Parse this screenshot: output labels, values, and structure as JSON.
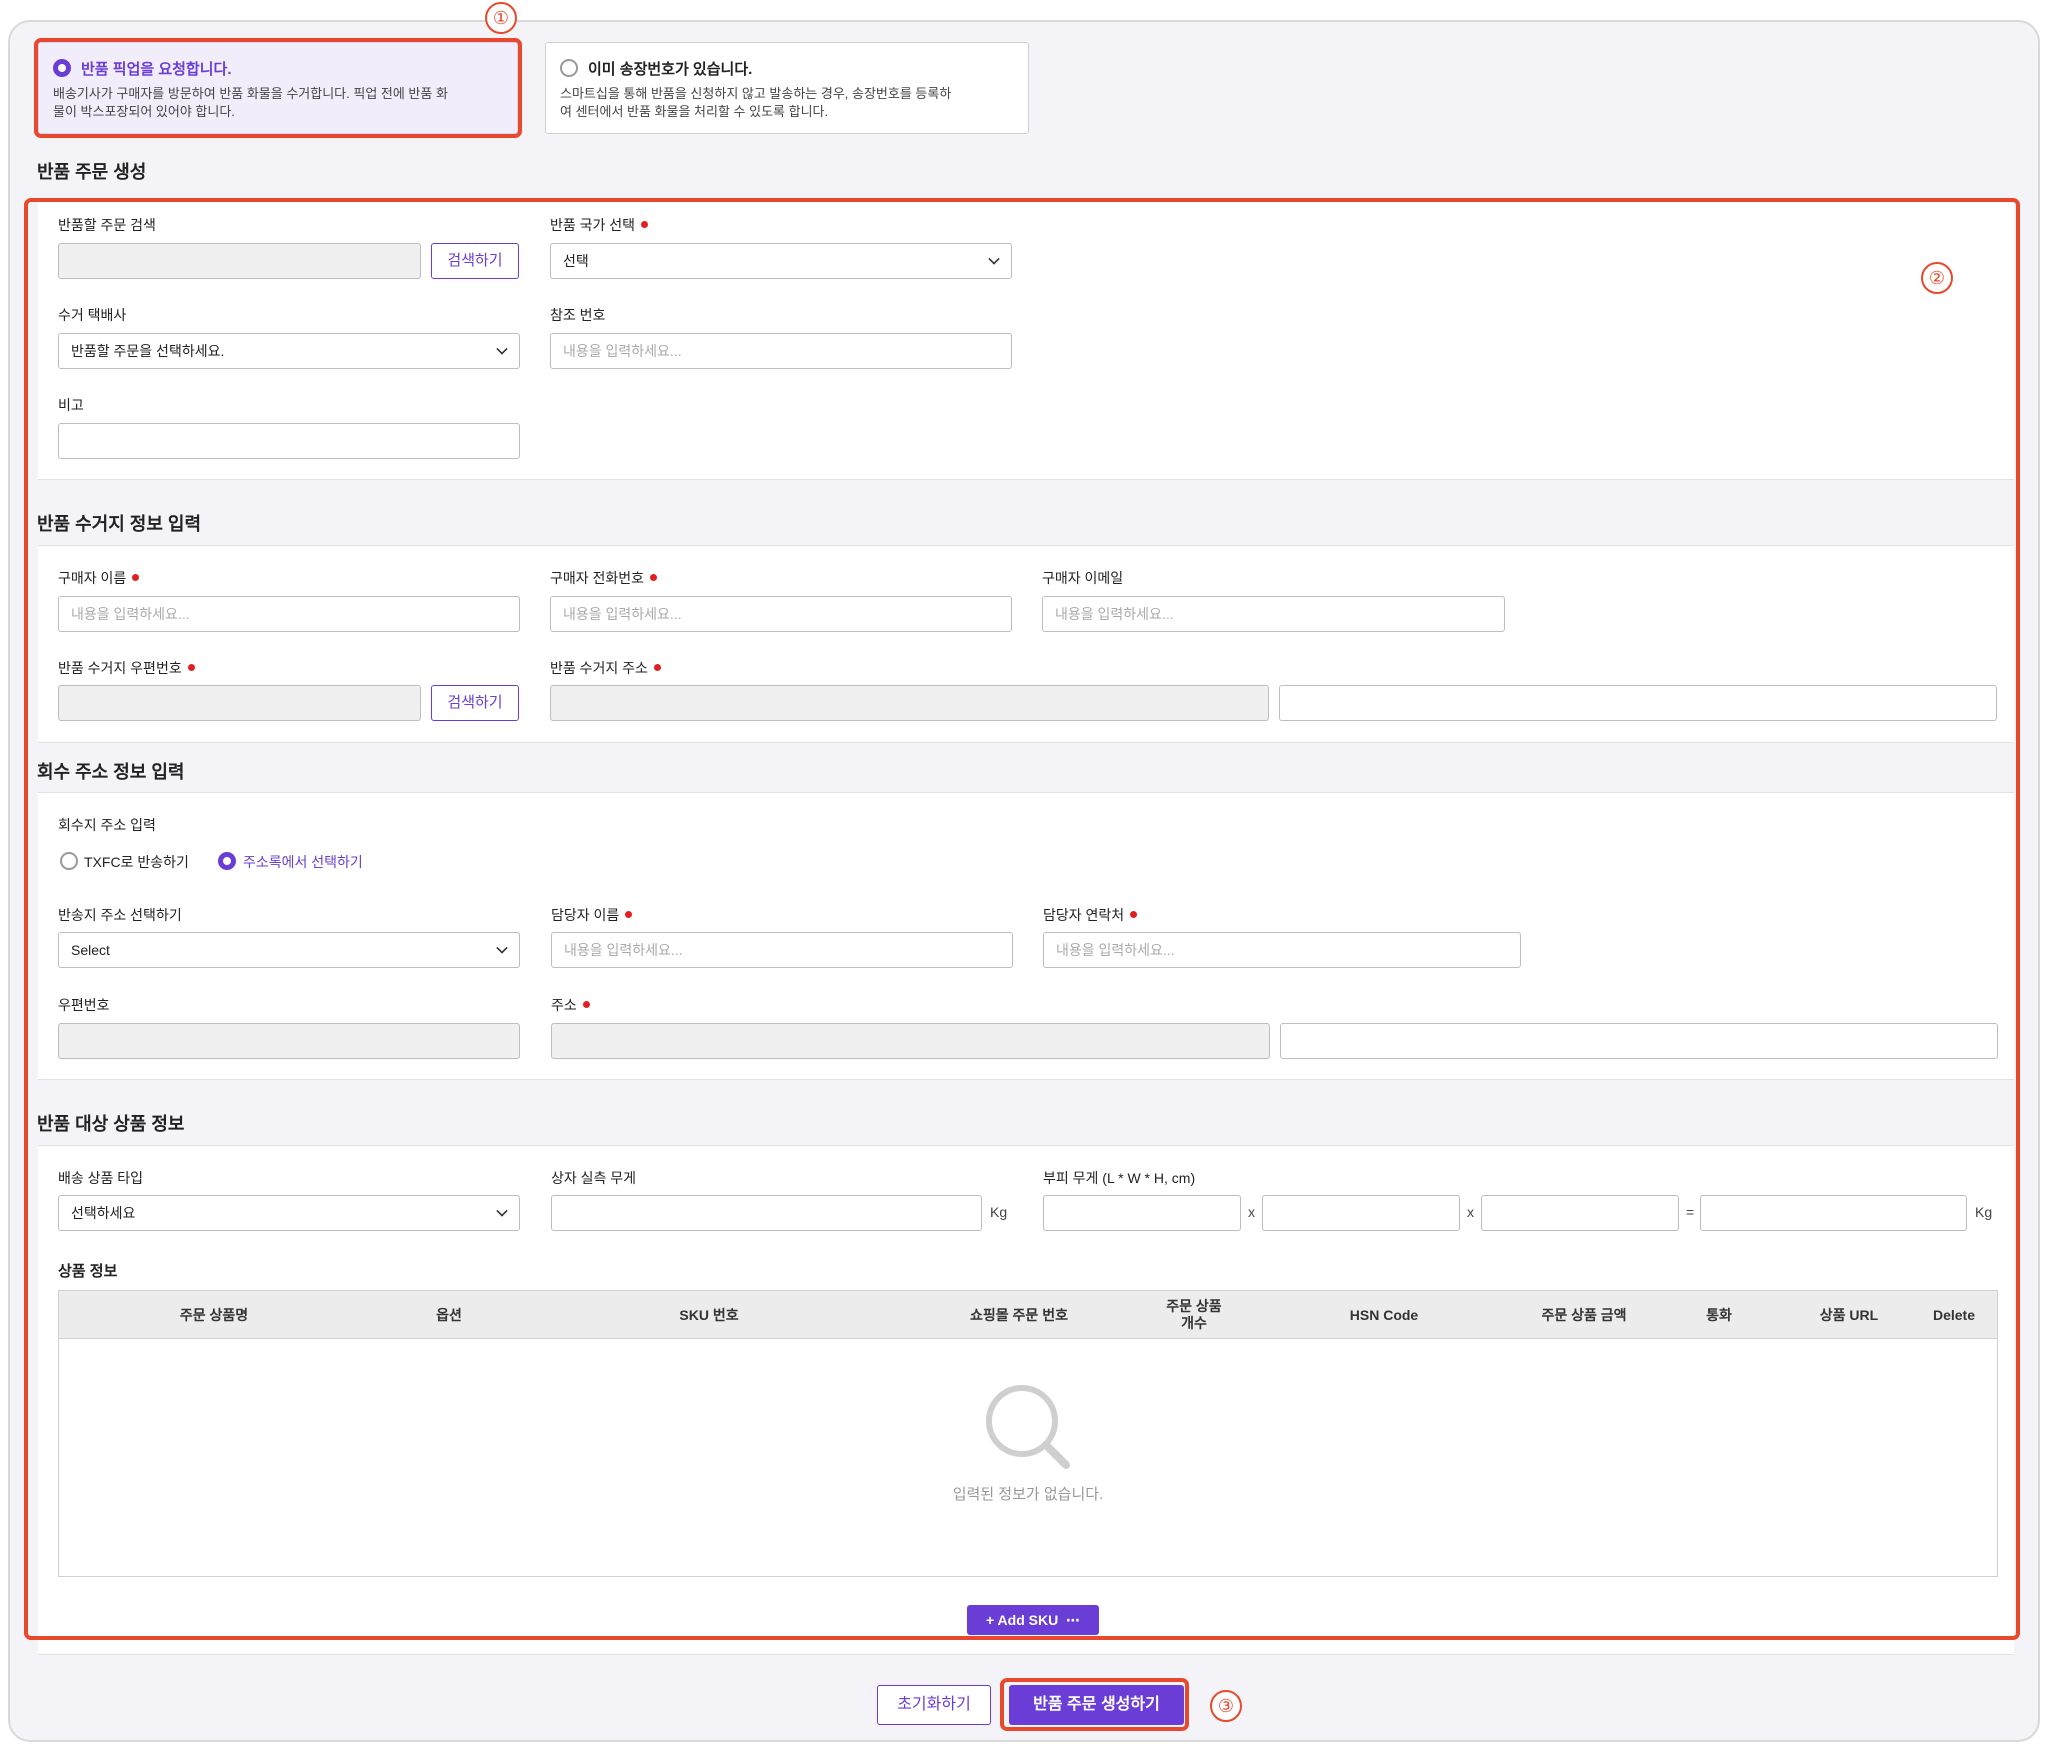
{
  "options": [
    {
      "title": "반품 픽업을 요청합니다.",
      "desc_line1": "배송기사가 구매자를 방문하여 반품 화물을 수거합니다. 픽업 전에 반품 화",
      "desc_line2": "물이 박스포장되어 있어야 합니다.",
      "selected": true
    },
    {
      "title": "이미 송장번호가 있습니다.",
      "desc_line1": "스마트십을 통해 반품을 신청하지 않고 발송하는 경우, 송장번호를 등록하",
      "desc_line2": "여 센터에서 반품 화물을 처리할 수 있도록 합니다.",
      "selected": false
    }
  ],
  "annotations": {
    "one": "①",
    "two": "②",
    "three": "③"
  },
  "create_section": {
    "title": "반품 주문 생성",
    "search_label": "반품할 주문 검색",
    "search_button": "검색하기",
    "country_label": "반품 국가 선택",
    "country_value": "선택",
    "courier_label": "수거 택배사",
    "courier_value": "반품할 주문을 선택하세요.",
    "ref_label": "참조 번호",
    "ref_placeholder": "내용을 입력하세요...",
    "memo_label": "비고"
  },
  "pickup_section": {
    "title": "반품 수거지 정보 입력",
    "buyer_name_label": "구매자 이름",
    "buyer_phone_label": "구매자 전화번호",
    "buyer_email_label": "구매자 이메일",
    "placeholder": "내용을 입력하세요...",
    "zip_label": "반품 수거지 우편번호",
    "zip_button": "검색하기",
    "address_label": "반품 수거지 주소"
  },
  "return_section": {
    "title": "회수 주소 정보 입력",
    "address_input_label": "회수지 주소 입력",
    "radio_txfc": "TXFC로 반송하기",
    "radio_book": "주소록에서 선택하기",
    "select_label": "반송지 주소 선택하기",
    "select_value": "Select",
    "contact_name_label": "담당자 이름",
    "contact_phone_label": "담당자 연락처",
    "placeholder": "내용을 입력하세요...",
    "zip_label": "우편번호",
    "address_label": "주소"
  },
  "product_section": {
    "title": "반품 대상 상품 정보",
    "type_label": "배송 상품 타입",
    "type_value": "선택하세요",
    "weight_label": "상자 실측 무게",
    "weight_unit": "Kg",
    "volume_label": "부피 무게 (L * W * H, cm)",
    "x1": "x",
    "x2": "x",
    "eq": "=",
    "volume_unit": "Kg",
    "info_label": "상품 정보",
    "columns": [
      "주문 상품명",
      "옵션",
      "SKU 번호",
      "쇼핑몰 주문 번호",
      "주문 상품\n개수",
      "HSN Code",
      "주문 상품 금액",
      "통화",
      "상품 URL",
      "Delete"
    ],
    "empty_text": "입력된 정보가 없습니다.",
    "add_button": "+ Add SKU  ⋯"
  },
  "footer": {
    "reset_button": "초기화하기",
    "submit_button": "반품 주문 생성하기"
  },
  "colors": {
    "accent": "#6a3ed6",
    "highlight": "#e8482c",
    "required": "#e02020"
  }
}
